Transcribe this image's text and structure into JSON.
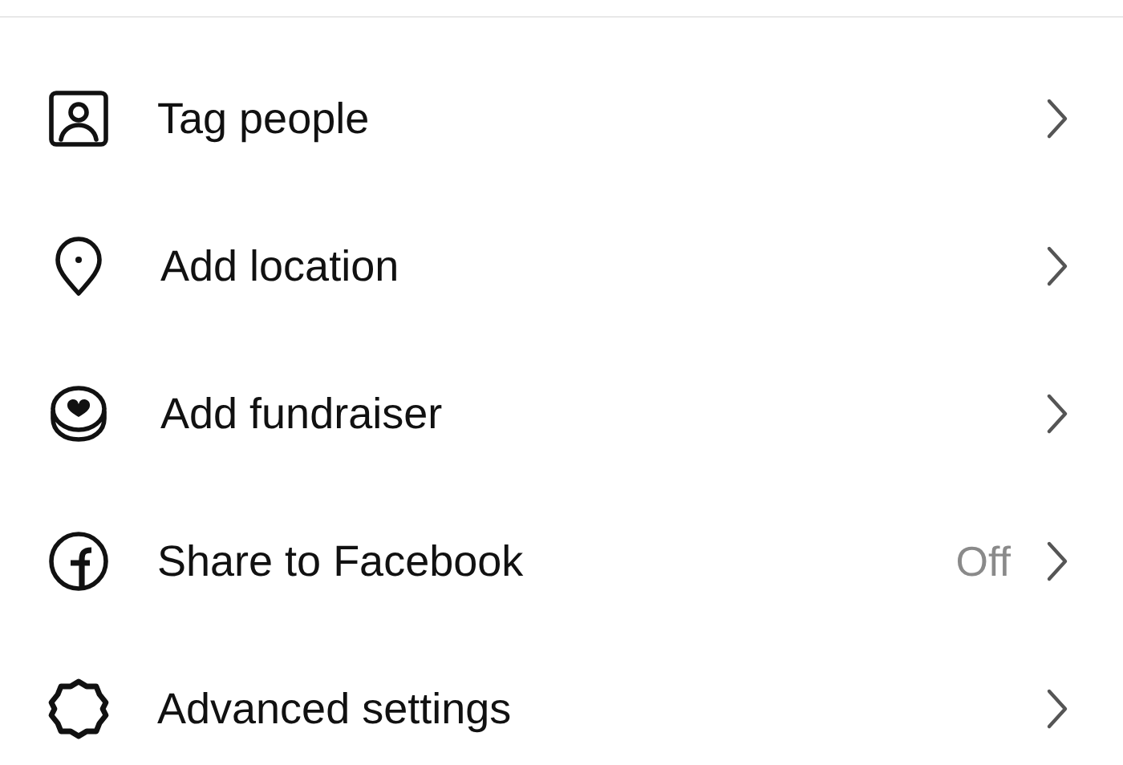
{
  "menu": [
    {
      "kind": "tag",
      "label": "Tag people"
    },
    {
      "kind": "location",
      "label": "Add location"
    },
    {
      "kind": "fundraiser",
      "label": "Add fundraiser"
    },
    {
      "kind": "facebook",
      "label": "Share to Facebook",
      "value": "Off"
    },
    {
      "kind": "settings",
      "label": "Advanced settings"
    }
  ]
}
